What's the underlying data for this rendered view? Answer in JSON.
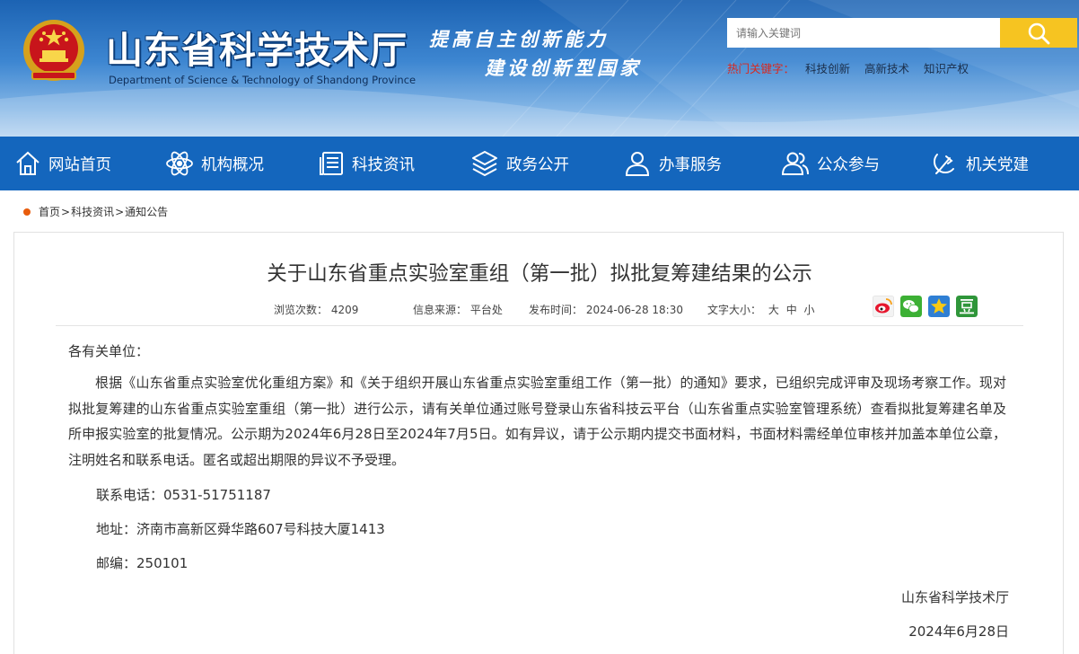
{
  "header": {
    "site_title": "山东省科学技术厅",
    "site_title_en": "Department of Science & Technology of Shandong Province",
    "slogan_line1": "提高自主创新能力",
    "slogan_line2": "建设创新型国家"
  },
  "search": {
    "placeholder": "请输入关键词",
    "value": ""
  },
  "hot_keywords": {
    "label": "热门关键字：",
    "items": [
      "科技创新",
      "高新技术",
      "知识产权"
    ]
  },
  "nav": {
    "items": [
      {
        "label": "网站首页",
        "icon": "home-icon"
      },
      {
        "label": "机构概况",
        "icon": "atom-icon"
      },
      {
        "label": "科技资讯",
        "icon": "news-list-icon"
      },
      {
        "label": "政务公开",
        "icon": "layers-icon"
      },
      {
        "label": "办事服务",
        "icon": "user-service-icon"
      },
      {
        "label": "公众参与",
        "icon": "users-icon"
      },
      {
        "label": "机关党建",
        "icon": "party-emblem-icon"
      }
    ]
  },
  "breadcrumb": {
    "items": [
      "首页",
      "科技资讯",
      "通知公告"
    ],
    "separator": ">"
  },
  "article": {
    "title": "关于山东省重点实验室重组（第一批）拟批复筹建结果的公示",
    "meta": {
      "views_label": "浏览次数：",
      "views": "4209",
      "source_label": "信息来源：",
      "source": "平台处",
      "date_label": "发布时间：",
      "date": "2024-06-28 18:30",
      "font_size_label": "文字大小：",
      "font_sizes": [
        "大",
        "中",
        "小"
      ]
    },
    "share_icons": [
      "weibo-icon",
      "wechat-icon",
      "qzone-icon",
      "douban-icon"
    ],
    "salutation": "各有关单位：",
    "paragraph": "根据《山东省重点实验室优化重组方案》和《关于组织开展山东省重点实验室重组工作（第一批）的通知》要求，已组织完成评审及现场考察工作。现对拟批复筹建的山东省重点实验室重组（第一批）进行公示，请有关单位通过账号登录山东省科技云平台（山东省重点实验室管理系统）查看拟批复筹建名单及所申报实验室的批复情况。公示期为2024年6月28日至2024年7月5日。如有异议，请于公示期内提交书面材料，书面材料需经单位审核并加盖本单位公章，注明姓名和联系电话。匿名或超出期限的异议不予受理。",
    "contact_phone": "联系电话：0531-51751187",
    "address": "地址：济南市高新区舜华路607号科技大厦1413",
    "postcode": "邮编：250101",
    "signature_org": "山东省科学技术厅",
    "signature_date": "2024年6月28日"
  },
  "colors": {
    "nav_bg": "#1466bd",
    "search_button": "#f6c421",
    "hot_label": "#d9281e",
    "breadcrumb_dot": "#e85c0d"
  }
}
